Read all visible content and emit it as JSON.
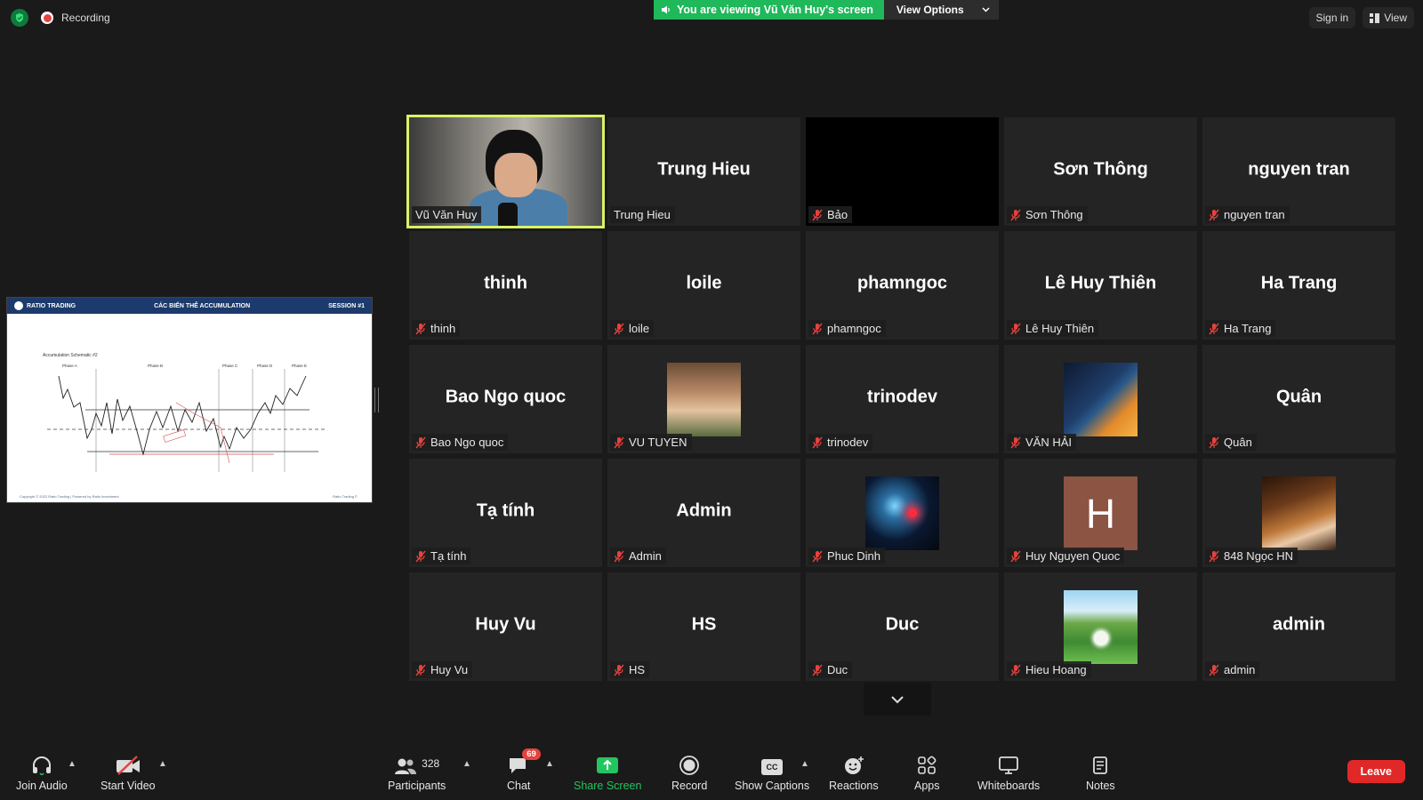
{
  "top_left": {
    "recording_label": "Recording"
  },
  "banner": {
    "viewing_text": "You are viewing Vũ Văn Huy's screen",
    "view_options_label": "View Options"
  },
  "top_right": {
    "sign_in_label": "Sign in",
    "view_label": "View"
  },
  "shared_slide": {
    "brand": "RATIO TRADING",
    "title": "CÁC BIẾN THỂ ACCUMULATION",
    "session": "SESSION #1",
    "chart_title": "Accumulation Schematic #2",
    "phases": [
      "Phase A",
      "Phase B",
      "Phase C",
      "Phase D",
      "Phase E"
    ],
    "footer_left": "Copyright © 2022 Ratio Trading | Powered by Ratio Investment",
    "footer_right": "Ratio Trading ©"
  },
  "participants": [
    {
      "name": "Vũ Văn Huy",
      "display": "",
      "type": "video",
      "active": true,
      "muted": false
    },
    {
      "name": "Trung Hieu",
      "display": "Trung Hieu",
      "type": "text",
      "muted": false
    },
    {
      "name": "Bảo",
      "display": "",
      "type": "black",
      "muted": true
    },
    {
      "name": "Sơn Thông",
      "display": "Sơn Thông",
      "type": "text",
      "muted": true
    },
    {
      "name": "nguyen tran",
      "display": "nguyen tran",
      "type": "text",
      "muted": true
    },
    {
      "name": "thinh",
      "display": "thinh",
      "type": "text",
      "muted": true
    },
    {
      "name": "loile",
      "display": "loile",
      "type": "text",
      "muted": true
    },
    {
      "name": "phamngoc",
      "display": "phamngoc",
      "type": "text",
      "muted": true
    },
    {
      "name": "Lê Huy Thiên",
      "display": "Lê Huy Thiên",
      "type": "text",
      "muted": true
    },
    {
      "name": "Ha Trang",
      "display": "Ha Trang",
      "type": "text",
      "muted": true
    },
    {
      "name": "Bao Ngo quoc",
      "display": "Bao Ngo quoc",
      "type": "text",
      "muted": true
    },
    {
      "name": "VU TUYEN",
      "display": "",
      "type": "avatar",
      "avatar": "av-vutuyen",
      "muted": true
    },
    {
      "name": "trinodev",
      "display": "trinodev",
      "type": "text",
      "muted": true
    },
    {
      "name": "VĂN HẢI",
      "display": "",
      "type": "avatar",
      "avatar": "av-vanhai",
      "muted": true
    },
    {
      "name": "Quân",
      "display": "Quân",
      "type": "text",
      "muted": true
    },
    {
      "name": "Tạ tính",
      "display": "Tạ tính",
      "type": "text",
      "muted": true
    },
    {
      "name": "Admin",
      "display": "Admin",
      "type": "text",
      "muted": true
    },
    {
      "name": "Phuc Dinh",
      "display": "",
      "type": "avatar",
      "avatar": "av-phuc",
      "muted": true
    },
    {
      "name": "Huy Nguyen Quoc",
      "display": "",
      "type": "avatar",
      "avatar": "av-h",
      "letter": "H",
      "muted": true
    },
    {
      "name": "848 Ngọc HN",
      "display": "",
      "type": "avatar",
      "avatar": "av-guitar",
      "muted": true
    },
    {
      "name": "Huy Vu",
      "display": "Huy Vu",
      "type": "text",
      "muted": true
    },
    {
      "name": "HS",
      "display": "HS",
      "type": "text",
      "muted": true
    },
    {
      "name": "Duc",
      "display": "Duc",
      "type": "text",
      "muted": true
    },
    {
      "name": "Hieu Hoang",
      "display": "",
      "type": "avatar",
      "avatar": "av-dandelion",
      "muted": true
    },
    {
      "name": "admin",
      "display": "admin",
      "type": "text",
      "muted": true
    }
  ],
  "toolbar": {
    "join_audio": "Join Audio",
    "start_video": "Start Video",
    "participants": "Participants",
    "participants_count": "328",
    "chat": "Chat",
    "chat_badge": "69",
    "share_screen": "Share Screen",
    "record": "Record",
    "show_captions": "Show Captions",
    "cc_label": "CC",
    "reactions": "Reactions",
    "apps": "Apps",
    "whiteboards": "Whiteboards",
    "notes": "Notes",
    "leave": "Leave"
  },
  "colors": {
    "green": "#1fb85a",
    "active_border": "#d9f266",
    "leave": "#e02828",
    "badge": "#e5433e"
  }
}
